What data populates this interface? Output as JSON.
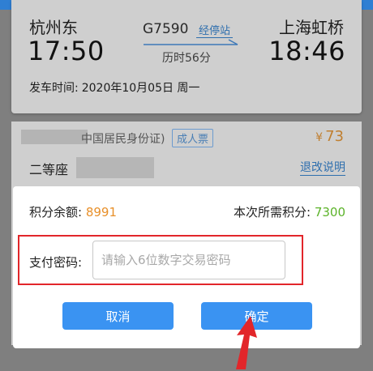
{
  "trip": {
    "from_station": "杭州东",
    "to_station": "上海虹桥",
    "train_no": "G7590",
    "stops_link": "经停站",
    "duration": "历时56分",
    "depart_time": "17:50",
    "arrive_time": "18:46",
    "depart_label": "发车时间:",
    "depart_date": "2020年10月05日 周一"
  },
  "passenger": {
    "id_type": "中国居民身份证)",
    "ticket_type": "成人票",
    "currency": "¥",
    "price": "73",
    "seat_class": "二等座",
    "refund_link": "退改说明"
  },
  "dialog": {
    "points_balance_label": "积分余额:",
    "points_balance": "8991",
    "points_required_label": "本次所需积分:",
    "points_required": "7300",
    "password_label": "支付密码:",
    "password_placeholder": "请输入6位数字交易密码",
    "cancel_label": "取消",
    "confirm_label": "确定"
  },
  "colors": {
    "accent_blue": "#3a93f2",
    "highlight_red": "#e2262a",
    "balance_orange": "#e8902a",
    "required_green": "#5cb32a"
  }
}
